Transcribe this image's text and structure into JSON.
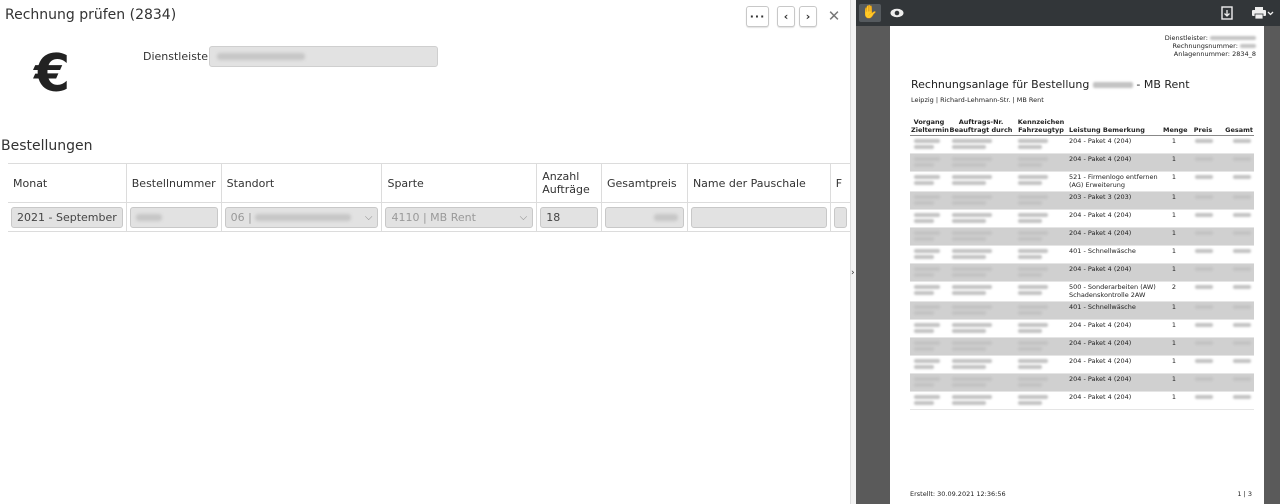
{
  "header": {
    "title": "Rechnung prüfen (2834)",
    "more_label": "···",
    "prev_label": "‹",
    "next_label": "›",
    "close_label": "✕"
  },
  "dienstleister": {
    "label": "Dienstleister"
  },
  "bestellungen": {
    "section_title": "Bestellungen",
    "columns": [
      "Monat",
      "Bestellnummer",
      "Standort",
      "Sparte",
      "Anzahl Aufträge",
      "Gesamtpreis",
      "Name der Pauschale",
      "F"
    ],
    "row": {
      "monat": "2021 - September",
      "standort_prefix": "06 |",
      "sparte": "4110 | MB Rent",
      "anzahl": "18"
    }
  },
  "pdf": {
    "header_lines": [
      "Dienstleister:",
      "Rechnungsnummer:",
      "Anlagennummer: 2834_8"
    ],
    "title_prefix": "Rechnungsanlage für Bestellung",
    "title_suffix": "- MB Rent",
    "subtitle": "Leipzig | Richard-Lehmann-Str. | MB Rent",
    "columns": [
      "Vorgang Zieltermin",
      "Auftrags-Nr. Beauftragt durch",
      "Kennzeichen Fahrzeugtyp",
      "Leistung Bemerkung",
      "Menge",
      "Preis",
      "Gesamt"
    ],
    "rows": [
      {
        "leistung": "204 - Paket 4 (204)",
        "menge": "1"
      },
      {
        "leistung": "204 - Paket 4 (204)",
        "menge": "1"
      },
      {
        "leistung": "521 - Firmenlogo entfernen (AG) Erweiterung",
        "menge": "1"
      },
      {
        "leistung": "203 - Paket 3 (203)",
        "menge": "1"
      },
      {
        "leistung": "204 - Paket 4 (204)",
        "menge": "1"
      },
      {
        "leistung": "204 - Paket 4 (204)",
        "menge": "1"
      },
      {
        "leistung": "401 - Schnellwäsche",
        "menge": "1"
      },
      {
        "leistung": "204 - Paket 4 (204)",
        "menge": "1"
      },
      {
        "leistung": "500 - Sonderarbeiten (AW) Schadenskontrolle 2AW",
        "menge": "2"
      },
      {
        "leistung": "401 - Schnellwäsche",
        "menge": "1"
      },
      {
        "leistung": "204 - Paket 4 (204)",
        "menge": "1"
      },
      {
        "leistung": "204 - Paket 4 (204)",
        "menge": "1"
      },
      {
        "leistung": "204 - Paket 4 (204)",
        "menge": "1"
      },
      {
        "leistung": "204 - Paket 4 (204)",
        "menge": "1"
      },
      {
        "leistung": "204 - Paket 4 (204)",
        "menge": "1"
      }
    ],
    "footer": "Erstellt: 30.09.2021 12:36:56",
    "page_no": "1 | 3"
  },
  "icons": [
    "euro-icon",
    "hand-tool-icon",
    "eye-icon",
    "fit-page-icon",
    "print-icon",
    "close-icon",
    "chevron-left-icon",
    "chevron-right-icon",
    "more-icon",
    "chevron-down-icon"
  ]
}
